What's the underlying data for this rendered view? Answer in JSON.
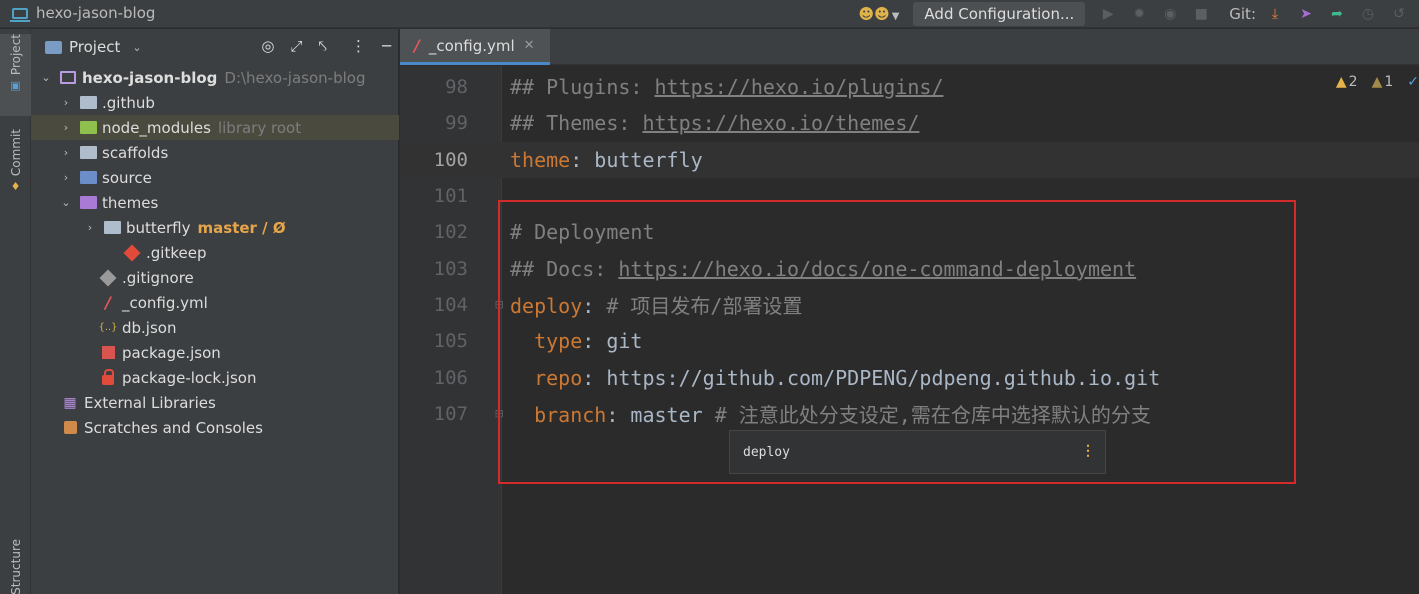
{
  "window": {
    "title": "hexo-jason-blog"
  },
  "toolbar": {
    "add_configuration": "Add Configuration...",
    "git_label": "Git:"
  },
  "tool_strip": {
    "project": "Project",
    "commit": "Commit",
    "structure": "Structure"
  },
  "project_panel": {
    "title": "Project",
    "tree": [
      {
        "name": "hexo-jason-blog",
        "extra": "D:\\hexo-jason-blog"
      },
      {
        "name": ".github"
      },
      {
        "name": "node_modules",
        "extra": "library root"
      },
      {
        "name": "scaffolds"
      },
      {
        "name": "source"
      },
      {
        "name": "themes"
      },
      {
        "name": "butterfly",
        "branch": "master / Ø"
      },
      {
        "name": ".gitkeep"
      },
      {
        "name": ".gitignore"
      },
      {
        "name": "_config.yml"
      },
      {
        "name": "db.json",
        "icon_text": "{..}"
      },
      {
        "name": "package.json"
      },
      {
        "name": "package-lock.json"
      },
      {
        "name": "External Libraries"
      },
      {
        "name": "Scratches and Consoles"
      }
    ]
  },
  "editor": {
    "tab_label": "_config.yml",
    "inspections": {
      "warnings": "2",
      "weak_warnings": "1"
    },
    "lines": [
      {
        "n": "98",
        "t1": "## Plugins: ",
        "t2": "https://hexo.io/plugins/"
      },
      {
        "n": "99",
        "t1": "## Themes: ",
        "t2": "https://hexo.io/themes/"
      },
      {
        "n": "100",
        "k": "theme",
        "t1": ": butterfly"
      },
      {
        "n": "101"
      },
      {
        "n": "102",
        "t1": "# Deployment"
      },
      {
        "n": "103",
        "t1": "## Docs: ",
        "t2": "https://hexo.io/docs/one-command-deployment"
      },
      {
        "n": "104",
        "k": "deploy",
        "t1": ": ",
        "t2": "# 项目发布/部署设置"
      },
      {
        "n": "105",
        "k": "type",
        "t1": ": git"
      },
      {
        "n": "106",
        "k": "repo",
        "t1": ": https://github.com/PDPENG/pdpeng.github.io.git"
      },
      {
        "n": "107",
        "k": "branch",
        "t1": ": master ",
        "t2": "# 注意此处分支设定,需在仓库中选择默认的分支"
      }
    ],
    "breadcrumb": "deploy"
  }
}
